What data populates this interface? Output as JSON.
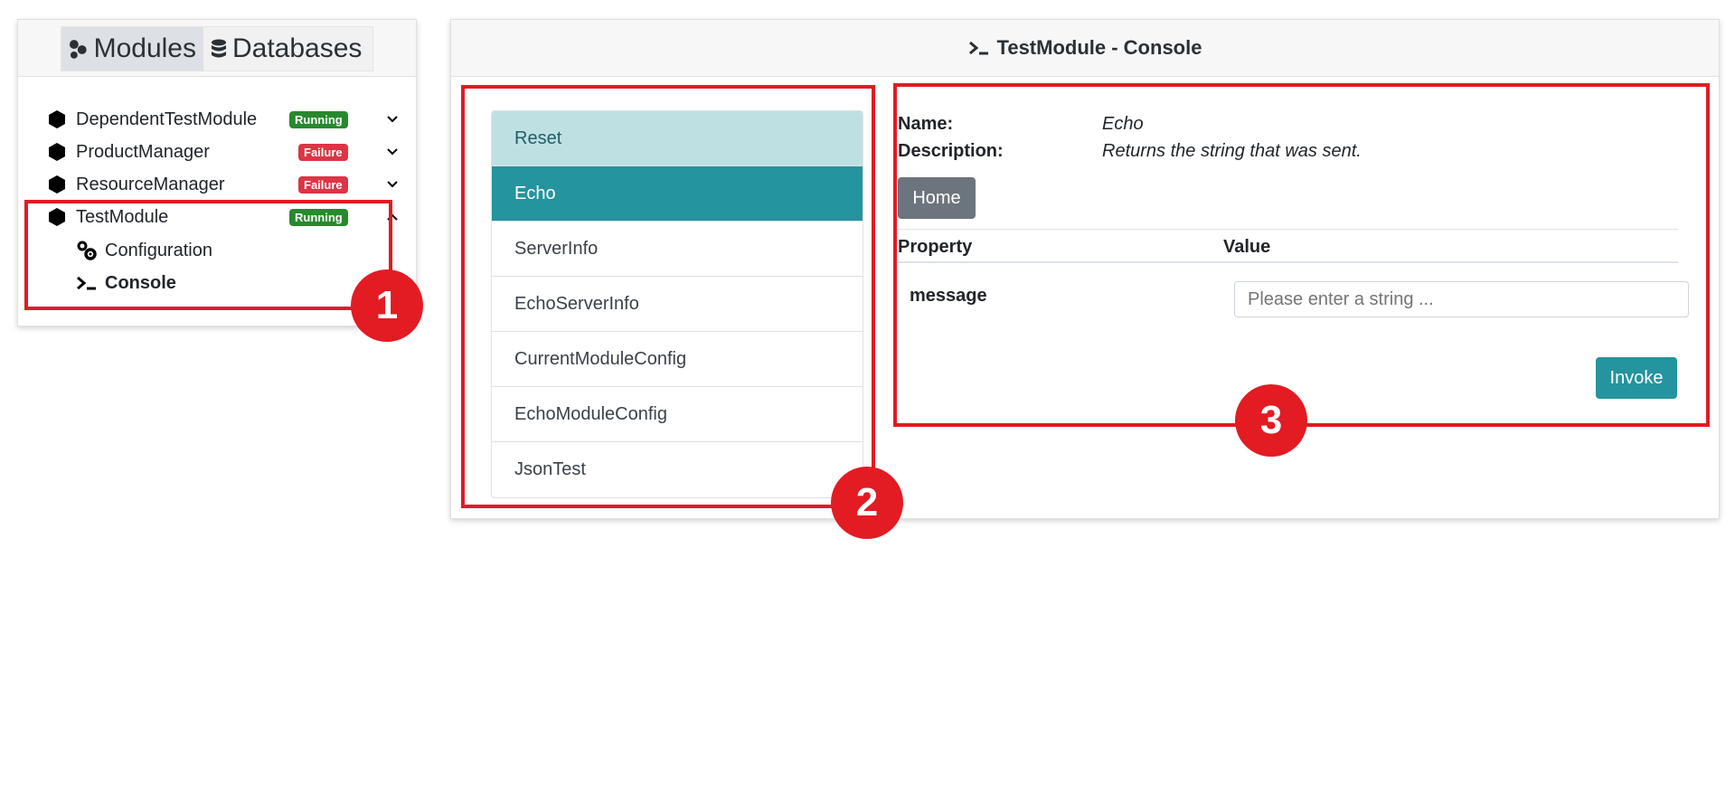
{
  "nav": {
    "tabs": [
      {
        "label": "Modules",
        "icon": "modules-icon"
      },
      {
        "label": "Databases",
        "icon": "database-icon"
      }
    ],
    "modules": [
      {
        "name": "DependentTestModule",
        "status": "Running"
      },
      {
        "name": "ProductManager",
        "status": "Failure"
      },
      {
        "name": "ResourceManager",
        "status": "Failure"
      },
      {
        "name": "TestModule",
        "status": "Running"
      }
    ],
    "sub_items": [
      {
        "label": "Configuration",
        "icon": "gears-icon"
      },
      {
        "label": "Console",
        "icon": "terminal-icon"
      }
    ]
  },
  "console": {
    "title": "TestModule - Console",
    "methods": [
      "Reset",
      "Echo",
      "ServerInfo",
      "EchoServerInfo",
      "CurrentModuleConfig",
      "EchoModuleConfig",
      "JsonTest"
    ],
    "selected_method": "Echo",
    "detail": {
      "name_label": "Name:",
      "name_value": "Echo",
      "description_label": "Description:",
      "description_value": "Returns the string that was sent.",
      "home_label": "Home",
      "property_header": "Property",
      "value_header": "Value",
      "param_name": "message",
      "param_placeholder": "Please enter a string ...",
      "invoke_label": "Invoke"
    }
  },
  "annotations": [
    "1",
    "2",
    "3"
  ],
  "colors": {
    "running": "#28892e",
    "failure": "#dc3545",
    "accent": "#24949e",
    "annotation": "#e31b23"
  }
}
